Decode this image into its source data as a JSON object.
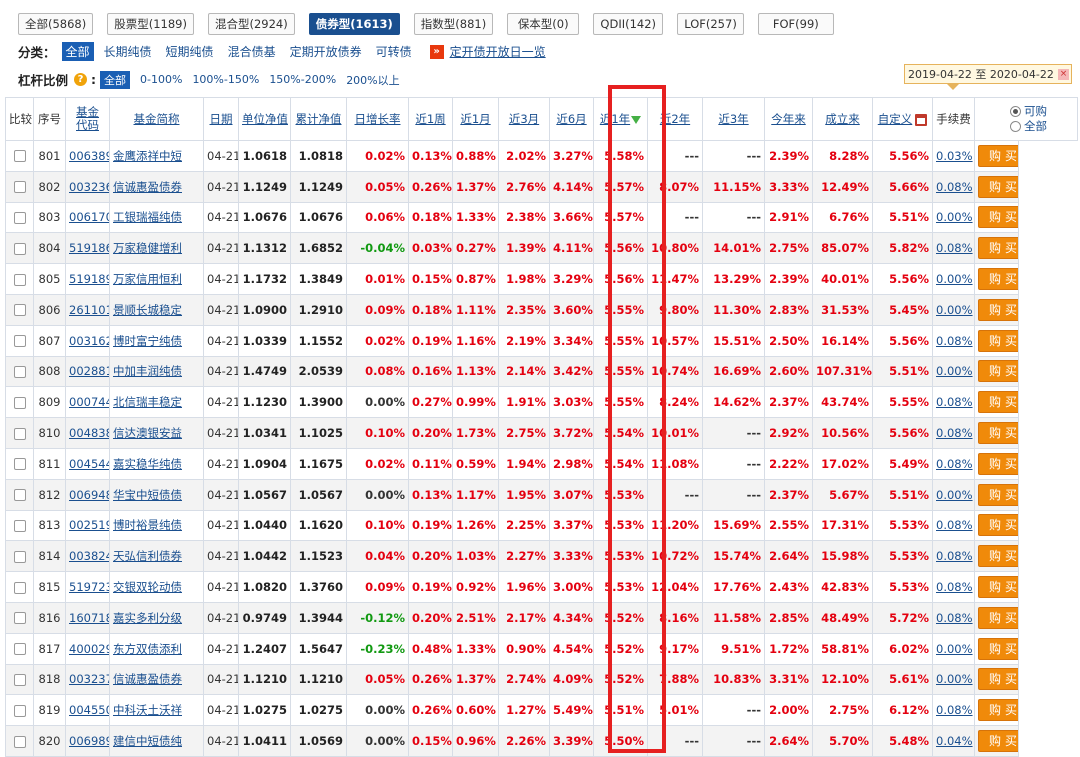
{
  "tabs": [
    {
      "label": "全部(5868)",
      "active": false
    },
    {
      "label": "股票型(1189)",
      "active": false
    },
    {
      "label": "混合型(2924)",
      "active": false
    },
    {
      "label": "债券型(1613)",
      "active": true
    },
    {
      "label": "指数型(881)",
      "active": false
    },
    {
      "label": "保本型(0)",
      "active": false
    },
    {
      "label": "QDII(142)",
      "active": false
    },
    {
      "label": "LOF(257)",
      "active": false
    },
    {
      "label": "FOF(99)",
      "active": false
    }
  ],
  "filters": {
    "category_label": "分类：",
    "category_options": [
      "全部",
      "长期纯债",
      "短期纯债",
      "混合债基",
      "定期开放债券",
      "可转债"
    ],
    "schedule_link": "定开债开放日一览",
    "leverage_label": "杠杆比例",
    "leverage_options": [
      "全部",
      "0-100%",
      "100%-150%",
      "150%-200%",
      "200%以上"
    ]
  },
  "date_range": {
    "text": "2019-04-22 至 2020-04-22"
  },
  "table": {
    "headers": {
      "compare": "比较",
      "seq": "序号",
      "code_line1": "基金",
      "code_line2": "代码",
      "name": "基金简称",
      "date": "日期",
      "nav": "单位净值",
      "acc_nav": "累计净值",
      "daily": "日增长率",
      "w1": "近1周",
      "m1": "近1月",
      "m3": "近3月",
      "m6": "近6月",
      "y1": "近1年",
      "y2": "近2年",
      "y3": "近3年",
      "ytd": "今年来",
      "since": "成立来",
      "custom": "自定义",
      "fee": "手续费",
      "radio_sellable": "可购",
      "radio_all": "全部"
    },
    "buy_label": "购买",
    "rows": [
      {
        "seq": "801",
        "code": "006389",
        "name": "金鹰添祥中短",
        "date": "04-21",
        "nav": "1.0618",
        "acc": "1.0818",
        "daily": "0.02%",
        "w1": "0.13%",
        "m1": "0.88%",
        "m3": "2.02%",
        "m6": "3.27%",
        "y1": "5.58%",
        "y2": "---",
        "y3": "---",
        "ytd": "2.39%",
        "since": "8.28%",
        "custom": "5.56%",
        "fee": "0.03%"
      },
      {
        "seq": "802",
        "code": "003236",
        "name": "信诚惠盈债券",
        "date": "04-21",
        "nav": "1.1249",
        "acc": "1.1249",
        "daily": "0.05%",
        "w1": "0.26%",
        "m1": "1.37%",
        "m3": "2.76%",
        "m6": "4.14%",
        "y1": "5.57%",
        "y2": "8.07%",
        "y3": "11.15%",
        "ytd": "3.33%",
        "since": "12.49%",
        "custom": "5.66%",
        "fee": "0.08%"
      },
      {
        "seq": "803",
        "code": "006170",
        "name": "工银瑞福纯债",
        "date": "04-21",
        "nav": "1.0676",
        "acc": "1.0676",
        "daily": "0.06%",
        "w1": "0.18%",
        "m1": "1.33%",
        "m3": "2.38%",
        "m6": "3.66%",
        "y1": "5.57%",
        "y2": "---",
        "y3": "---",
        "ytd": "2.91%",
        "since": "6.76%",
        "custom": "5.51%",
        "fee": "0.00%"
      },
      {
        "seq": "804",
        "code": "519186",
        "name": "万家稳健增利",
        "date": "04-21",
        "nav": "1.1312",
        "acc": "1.6852",
        "daily": "-0.04%",
        "w1": "0.03%",
        "m1": "0.27%",
        "m3": "1.39%",
        "m6": "4.11%",
        "y1": "5.56%",
        "y2": "10.80%",
        "y3": "14.01%",
        "ytd": "2.75%",
        "since": "85.07%",
        "custom": "5.82%",
        "fee": "0.08%"
      },
      {
        "seq": "805",
        "code": "519189",
        "name": "万家信用恒利",
        "date": "04-21",
        "nav": "1.1732",
        "acc": "1.3849",
        "daily": "0.01%",
        "w1": "0.15%",
        "m1": "0.87%",
        "m3": "1.98%",
        "m6": "3.29%",
        "y1": "5.56%",
        "y2": "11.47%",
        "y3": "13.29%",
        "ytd": "2.39%",
        "since": "40.01%",
        "custom": "5.56%",
        "fee": "0.00%"
      },
      {
        "seq": "806",
        "code": "261101",
        "name": "景顺长城稳定",
        "date": "04-21",
        "nav": "1.0900",
        "acc": "1.2910",
        "daily": "0.09%",
        "w1": "0.18%",
        "m1": "1.11%",
        "m3": "2.35%",
        "m6": "3.60%",
        "y1": "5.55%",
        "y2": "9.80%",
        "y3": "11.30%",
        "ytd": "2.83%",
        "since": "31.53%",
        "custom": "5.45%",
        "fee": "0.00%"
      },
      {
        "seq": "807",
        "code": "003162",
        "name": "博时富宁纯债",
        "date": "04-21",
        "nav": "1.0339",
        "acc": "1.1552",
        "daily": "0.02%",
        "w1": "0.19%",
        "m1": "1.16%",
        "m3": "2.19%",
        "m6": "3.34%",
        "y1": "5.55%",
        "y2": "10.57%",
        "y3": "15.51%",
        "ytd": "2.50%",
        "since": "16.14%",
        "custom": "5.56%",
        "fee": "0.08%"
      },
      {
        "seq": "808",
        "code": "002881",
        "name": "中加丰润纯债",
        "date": "04-21",
        "nav": "1.4749",
        "acc": "2.0539",
        "daily": "0.08%",
        "w1": "0.16%",
        "m1": "1.13%",
        "m3": "2.14%",
        "m6": "3.42%",
        "y1": "5.55%",
        "y2": "10.74%",
        "y3": "16.69%",
        "ytd": "2.60%",
        "since": "107.31%",
        "custom": "5.51%",
        "fee": "0.00%"
      },
      {
        "seq": "809",
        "code": "000744",
        "name": "北信瑞丰稳定",
        "date": "04-21",
        "nav": "1.1230",
        "acc": "1.3900",
        "daily": "0.00%",
        "w1": "0.27%",
        "m1": "0.99%",
        "m3": "1.91%",
        "m6": "3.03%",
        "y1": "5.55%",
        "y2": "8.24%",
        "y3": "14.62%",
        "ytd": "2.37%",
        "since": "43.74%",
        "custom": "5.55%",
        "fee": "0.08%"
      },
      {
        "seq": "810",
        "code": "004838",
        "name": "信达澳银安益",
        "date": "04-21",
        "nav": "1.0341",
        "acc": "1.1025",
        "daily": "0.10%",
        "w1": "0.20%",
        "m1": "1.73%",
        "m3": "2.75%",
        "m6": "3.72%",
        "y1": "5.54%",
        "y2": "10.01%",
        "y3": "---",
        "ytd": "2.92%",
        "since": "10.56%",
        "custom": "5.56%",
        "fee": "0.08%"
      },
      {
        "seq": "811",
        "code": "004544",
        "name": "嘉实稳华纯债",
        "date": "04-21",
        "nav": "1.0904",
        "acc": "1.1675",
        "daily": "0.02%",
        "w1": "0.11%",
        "m1": "0.59%",
        "m3": "1.94%",
        "m6": "2.98%",
        "y1": "5.54%",
        "y2": "11.08%",
        "y3": "---",
        "ytd": "2.22%",
        "since": "17.02%",
        "custom": "5.49%",
        "fee": "0.08%"
      },
      {
        "seq": "812",
        "code": "006948",
        "name": "华宝中短债债",
        "date": "04-21",
        "nav": "1.0567",
        "acc": "1.0567",
        "daily": "0.00%",
        "w1": "0.13%",
        "m1": "1.17%",
        "m3": "1.95%",
        "m6": "3.07%",
        "y1": "5.53%",
        "y2": "---",
        "y3": "---",
        "ytd": "2.37%",
        "since": "5.67%",
        "custom": "5.51%",
        "fee": "0.00%"
      },
      {
        "seq": "813",
        "code": "002519",
        "name": "博时裕景纯债",
        "date": "04-21",
        "nav": "1.0440",
        "acc": "1.1620",
        "daily": "0.10%",
        "w1": "0.19%",
        "m1": "1.26%",
        "m3": "2.25%",
        "m6": "3.37%",
        "y1": "5.53%",
        "y2": "11.20%",
        "y3": "15.69%",
        "ytd": "2.55%",
        "since": "17.31%",
        "custom": "5.53%",
        "fee": "0.08%"
      },
      {
        "seq": "814",
        "code": "003824",
        "name": "天弘信利债券",
        "date": "04-21",
        "nav": "1.0442",
        "acc": "1.1523",
        "daily": "0.04%",
        "w1": "0.20%",
        "m1": "1.03%",
        "m3": "2.27%",
        "m6": "3.33%",
        "y1": "5.53%",
        "y2": "10.72%",
        "y3": "15.74%",
        "ytd": "2.64%",
        "since": "15.98%",
        "custom": "5.53%",
        "fee": "0.08%"
      },
      {
        "seq": "815",
        "code": "519723",
        "name": "交银双轮动债",
        "date": "04-21",
        "nav": "1.0820",
        "acc": "1.3760",
        "daily": "0.09%",
        "w1": "0.19%",
        "m1": "0.92%",
        "m3": "1.96%",
        "m6": "3.00%",
        "y1": "5.53%",
        "y2": "12.04%",
        "y3": "17.76%",
        "ytd": "2.43%",
        "since": "42.83%",
        "custom": "5.53%",
        "fee": "0.08%"
      },
      {
        "seq": "816",
        "code": "160718",
        "name": "嘉实多利分级",
        "date": "04-21",
        "nav": "0.9749",
        "acc": "1.3944",
        "daily": "-0.12%",
        "w1": "0.20%",
        "m1": "2.51%",
        "m3": "2.17%",
        "m6": "4.34%",
        "y1": "5.52%",
        "y2": "8.16%",
        "y3": "11.58%",
        "ytd": "2.85%",
        "since": "48.49%",
        "custom": "5.72%",
        "fee": "0.08%"
      },
      {
        "seq": "817",
        "code": "400029",
        "name": "东方双债添利",
        "date": "04-21",
        "nav": "1.2407",
        "acc": "1.5647",
        "daily": "-0.23%",
        "w1": "0.48%",
        "m1": "1.33%",
        "m3": "0.90%",
        "m6": "4.54%",
        "y1": "5.52%",
        "y2": "9.17%",
        "y3": "9.51%",
        "ytd": "1.72%",
        "since": "58.81%",
        "custom": "6.02%",
        "fee": "0.00%"
      },
      {
        "seq": "818",
        "code": "003237",
        "name": "信诚惠盈债券",
        "date": "04-21",
        "nav": "1.1210",
        "acc": "1.1210",
        "daily": "0.05%",
        "w1": "0.26%",
        "m1": "1.37%",
        "m3": "2.74%",
        "m6": "4.09%",
        "y1": "5.52%",
        "y2": "7.88%",
        "y3": "10.83%",
        "ytd": "3.31%",
        "since": "12.10%",
        "custom": "5.61%",
        "fee": "0.00%"
      },
      {
        "seq": "819",
        "code": "004550",
        "name": "中科沃土沃祥",
        "date": "04-21",
        "nav": "1.0275",
        "acc": "1.0275",
        "daily": "0.00%",
        "w1": "0.26%",
        "m1": "0.60%",
        "m3": "1.27%",
        "m6": "5.49%",
        "y1": "5.51%",
        "y2": "5.01%",
        "y3": "---",
        "ytd": "2.00%",
        "since": "2.75%",
        "custom": "6.12%",
        "fee": "0.08%"
      },
      {
        "seq": "820",
        "code": "006989",
        "name": "建信中短债纯",
        "date": "04-21",
        "nav": "1.0411",
        "acc": "1.0569",
        "daily": "0.00%",
        "w1": "0.15%",
        "m1": "0.96%",
        "m3": "2.26%",
        "m6": "3.39%",
        "y1": "5.50%",
        "y2": "---",
        "y3": "---",
        "ytd": "2.64%",
        "since": "5.70%",
        "custom": "5.48%",
        "fee": "0.04%"
      }
    ]
  }
}
